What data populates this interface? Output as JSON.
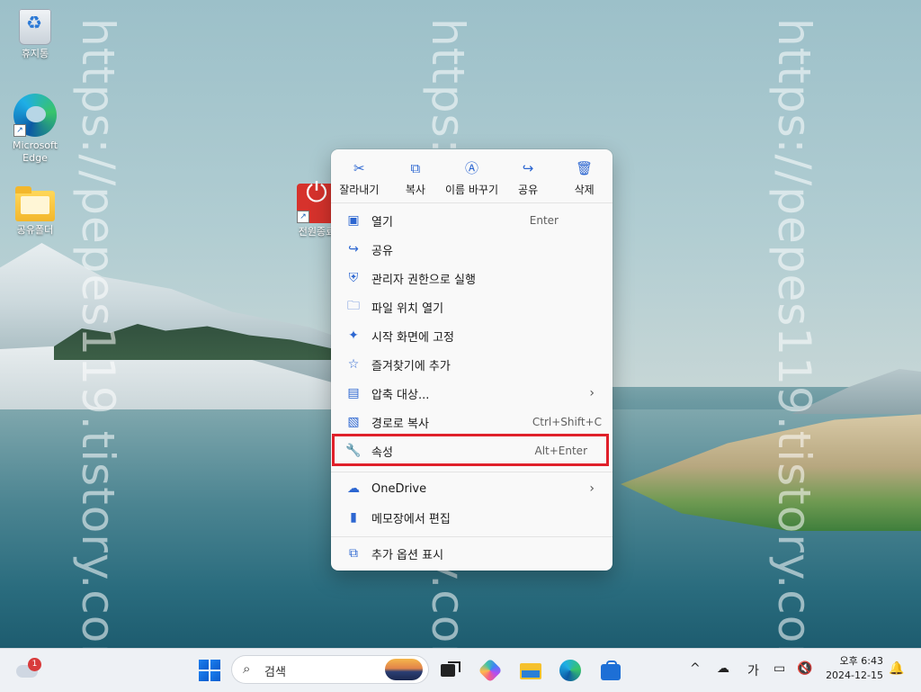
{
  "desktop": {
    "icons": [
      {
        "label": "휴지통"
      },
      {
        "label": "Microsoft Edge"
      },
      {
        "label": "공유폴더"
      },
      {
        "label": "전원종료"
      }
    ],
    "watermark": "https://pepes119.tistory.com/"
  },
  "context_menu": {
    "quick_actions": [
      {
        "label": "잘라내기",
        "icon": "scissors-icon",
        "glyph": "✂"
      },
      {
        "label": "복사",
        "icon": "copy-icon",
        "glyph": "⧉"
      },
      {
        "label": "이름 바꾸기",
        "icon": "rename-icon",
        "glyph": "Ⓐ"
      },
      {
        "label": "공유",
        "icon": "share-icon",
        "glyph": "↪"
      },
      {
        "label": "삭제",
        "icon": "trash-icon",
        "glyph": "🗑"
      }
    ],
    "items": [
      {
        "label": "열기",
        "shortcut": "Enter",
        "icon": "open-window-icon",
        "glyph": "▣"
      },
      {
        "label": "공유",
        "shortcut": "",
        "icon": "share-icon",
        "glyph": "↪"
      },
      {
        "label": "관리자 권한으로 실행",
        "shortcut": "",
        "icon": "shield-icon",
        "glyph": "⛨"
      },
      {
        "label": "파일 위치 열기",
        "shortcut": "",
        "icon": "folder-open-icon",
        "glyph": "🗀"
      },
      {
        "label": "시작 화면에 고정",
        "shortcut": "",
        "icon": "pin-icon",
        "glyph": "✦"
      },
      {
        "label": "즐겨찾기에 추가",
        "shortcut": "",
        "icon": "star-icon",
        "glyph": "☆"
      },
      {
        "label": "압축 대상...",
        "shortcut": "",
        "icon": "zip-folder-icon",
        "glyph": "▤",
        "submenu": true
      },
      {
        "label": "경로로 복사",
        "shortcut": "Ctrl+Shift+C",
        "icon": "copy-path-icon",
        "glyph": "▧"
      },
      {
        "label": "속성",
        "shortcut": "Alt+Enter",
        "icon": "wrench-icon",
        "glyph": "🔧"
      },
      {
        "label": "OneDrive",
        "shortcut": "",
        "icon": "onedrive-cloud-icon",
        "glyph": "☁",
        "submenu": true
      },
      {
        "label": "메모장에서 편집",
        "shortcut": "",
        "icon": "notepad-icon",
        "glyph": "▮"
      },
      {
        "label": "추가 옵션 표시",
        "shortcut": "",
        "icon": "more-options-icon",
        "glyph": "⧉"
      }
    ],
    "highlight_color": "#e0202a",
    "accent_color": "#2c66d1"
  },
  "taskbar": {
    "weather_badge": "1",
    "search_placeholder": "검색",
    "tray": {
      "chevron": "^",
      "ime": "가"
    },
    "clock": {
      "time": "오후 6:43",
      "date": "2024-12-15"
    }
  }
}
